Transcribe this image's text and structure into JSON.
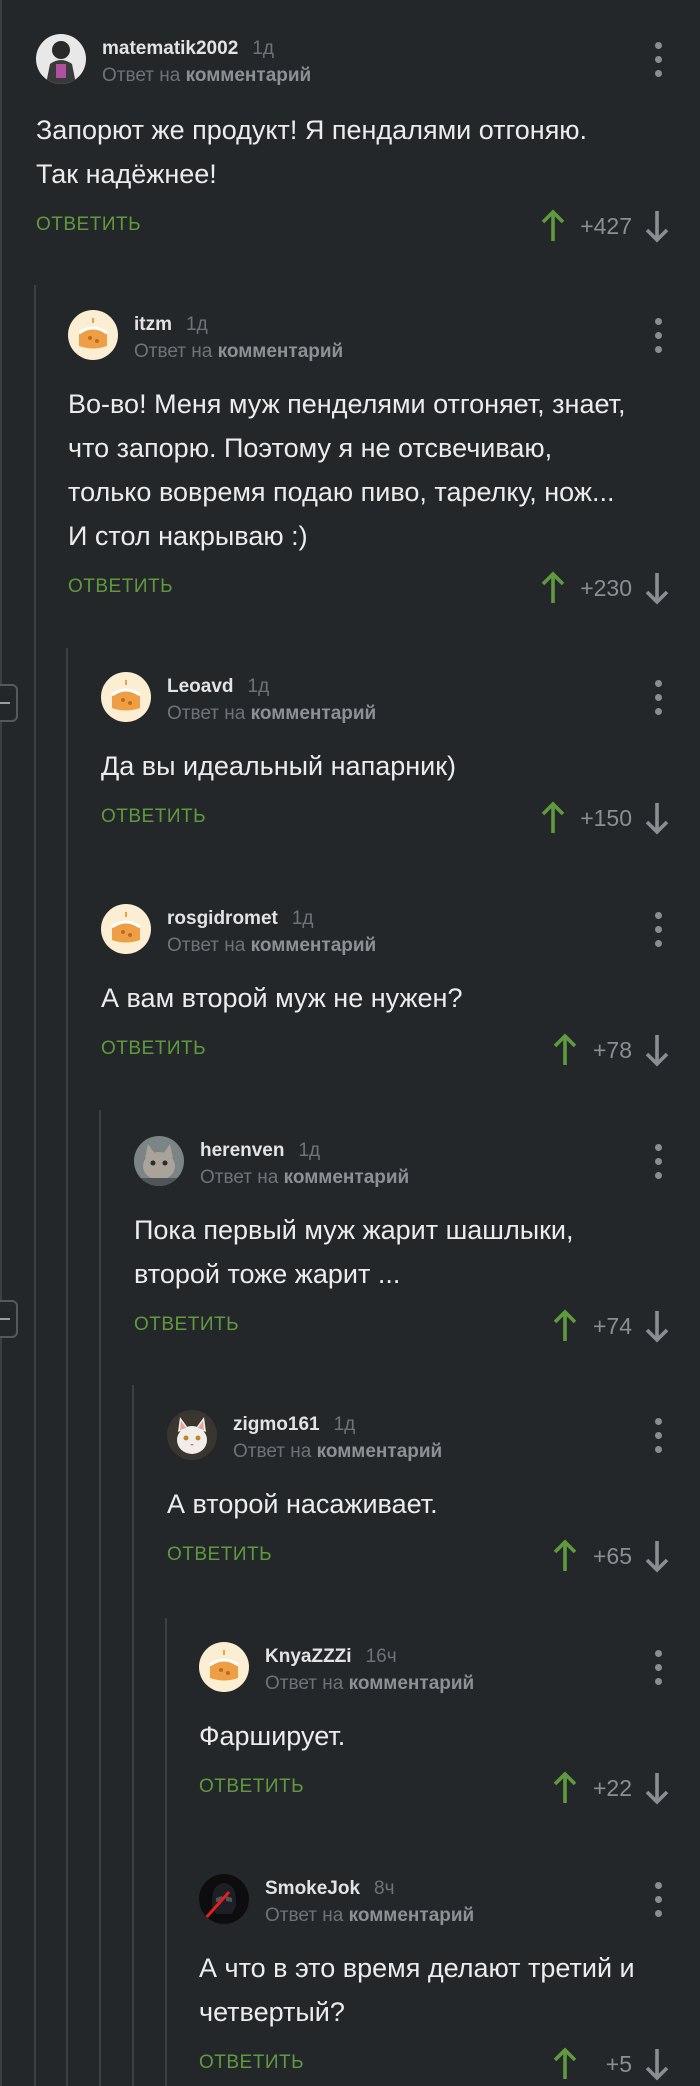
{
  "ui": {
    "reply_prefix": "Ответ на",
    "reply_target": "комментарий",
    "reply_label": "ОТВЕТИТЬ"
  },
  "colors": {
    "background": "#24272a",
    "reply_green": "#5f9a3e",
    "upvote_green": "#5f9a3e",
    "downvote_gray": "#8a8e93",
    "muted_text": "#6f7378"
  },
  "comments": [
    {
      "username": "matematik2002",
      "time": "1д",
      "text": [
        "Запорют же продукт! Я пендалями отгоняю.",
        "Так надёжнее!"
      ],
      "score": "+427",
      "avatar": "dark-figure-avatar"
    },
    {
      "username": "itzm",
      "time": "1д",
      "text": [
        "Во-во! Меня муж пенделями отгоняет, знает,",
        "что запорю. Поэтому я не отсвечиваю,",
        "только вовремя подаю пиво, тарелку, нож...",
        "И стол накрываю :)"
      ],
      "score": "+230",
      "avatar": "default-cake-avatar"
    },
    {
      "username": "Leoavd",
      "time": "1д",
      "text": [
        "Да вы идеальный напарник)"
      ],
      "score": "+150",
      "avatar": "default-cake-avatar"
    },
    {
      "username": "rosgidromet",
      "time": "1д",
      "text": [
        "А вам второй муж не нужен?"
      ],
      "score": "+78",
      "avatar": "default-cake-avatar"
    },
    {
      "username": "herenven",
      "time": "1д",
      "text": [
        "Пока первый муж жарит шашлыки,",
        "второй тоже жарит ..."
      ],
      "score": "+74",
      "avatar": "cat-photo-avatar"
    },
    {
      "username": "zigmo161",
      "time": "1д",
      "text": [
        "А второй насаживает."
      ],
      "score": "+65",
      "avatar": "white-cat-avatar"
    },
    {
      "username": "KnyaZZZi",
      "time": "16ч",
      "text": [
        "Фарширует."
      ],
      "score": "+22",
      "avatar": "default-cake-avatar"
    },
    {
      "username": "SmokeJok",
      "time": "8ч",
      "text": [
        "А что в это время делают третий и",
        "четвертый?"
      ],
      "score": "+5",
      "avatar": "darth-vader-avatar"
    }
  ]
}
